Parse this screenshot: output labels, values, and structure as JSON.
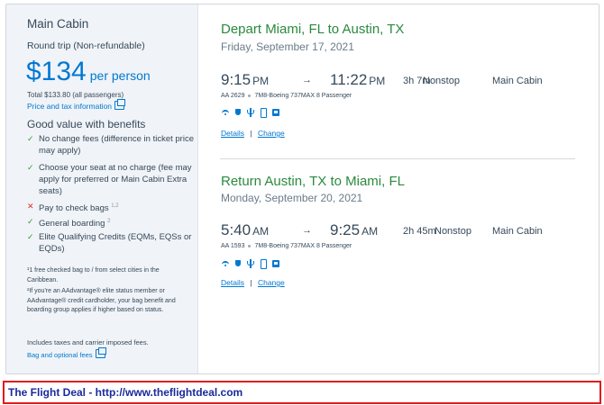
{
  "summary": {
    "cabin": "Main Cabin",
    "trip_type": "Round trip (Non-refundable)",
    "price": "$134",
    "per_person": "per person",
    "total": "Total $133.80 (all passengers)",
    "price_tax_link": "Price and tax information",
    "benefits_title": "Good value with benefits",
    "benefits": [
      {
        "mark": "✓",
        "status": "included",
        "text": "No change fees (difference in ticket price may apply)",
        "sup": ""
      },
      {
        "mark": "✓",
        "status": "included",
        "text": "Choose your seat at no charge (fee may apply for preferred or Main Cabin Extra seats)",
        "sup": ""
      },
      {
        "mark": "✕",
        "status": "excluded",
        "text": "Pay to check bags",
        "sup": "1,2"
      },
      {
        "mark": "✓",
        "status": "included",
        "text": "General boarding",
        "sup": "2"
      },
      {
        "mark": "✓",
        "status": "included",
        "text": "Elite Qualifying Credits (EQMs, EQSs or EQDs)",
        "sup": ""
      }
    ],
    "footnote1": "¹1 free checked bag to / from select cities in the Caribbean.",
    "footnote2": "²If you're an AAdvantage® elite status member or AAdvantage® credit cardholder, your bag benefit and boarding group applies if higher based on status.",
    "includes": "Includes taxes and carrier imposed fees.",
    "bag_fees_link": "Bag and optional fees"
  },
  "depart": {
    "title": "Depart Miami, FL to Austin, TX",
    "date": "Friday, September 17, 2021",
    "dep_time": "9:15",
    "dep_ampm": "PM",
    "arrow": "→",
    "arr_time": "11:22",
    "arr_ampm": "PM",
    "duration": "3h 7m",
    "stops": "Nonstop",
    "cabin": "Main Cabin",
    "flight_no": "AA 2629",
    "aircraft": "7M8-Boeing 737MAX 8 Passenger",
    "details": "Details",
    "change": "Change",
    "sep": "|"
  },
  "return": {
    "title": "Return Austin, TX to Miami, FL",
    "date": "Monday, September 20, 2021",
    "dep_time": "5:40",
    "dep_ampm": "AM",
    "arrow": "→",
    "arr_time": "9:25",
    "arr_ampm": "AM",
    "duration": "2h 45m",
    "stops": "Nonstop",
    "cabin": "Main Cabin",
    "flight_no": "AA 1593",
    "aircraft": "7M8-Boeing 737MAX 8 Passenger",
    "details": "Details",
    "change": "Change",
    "sep": "|"
  },
  "amenity_icons": [
    "wifi-icon",
    "shield-icon",
    "power-icon",
    "phone-icon",
    "screen-icon"
  ],
  "banner": {
    "text": "The Flight Deal - http://www.theflightdeal.com"
  },
  "colors": {
    "accent_blue": "#0078d2",
    "green_heading": "#2a8a3e",
    "banner_border": "#e11b1b",
    "banner_text": "#1a2a9a"
  }
}
